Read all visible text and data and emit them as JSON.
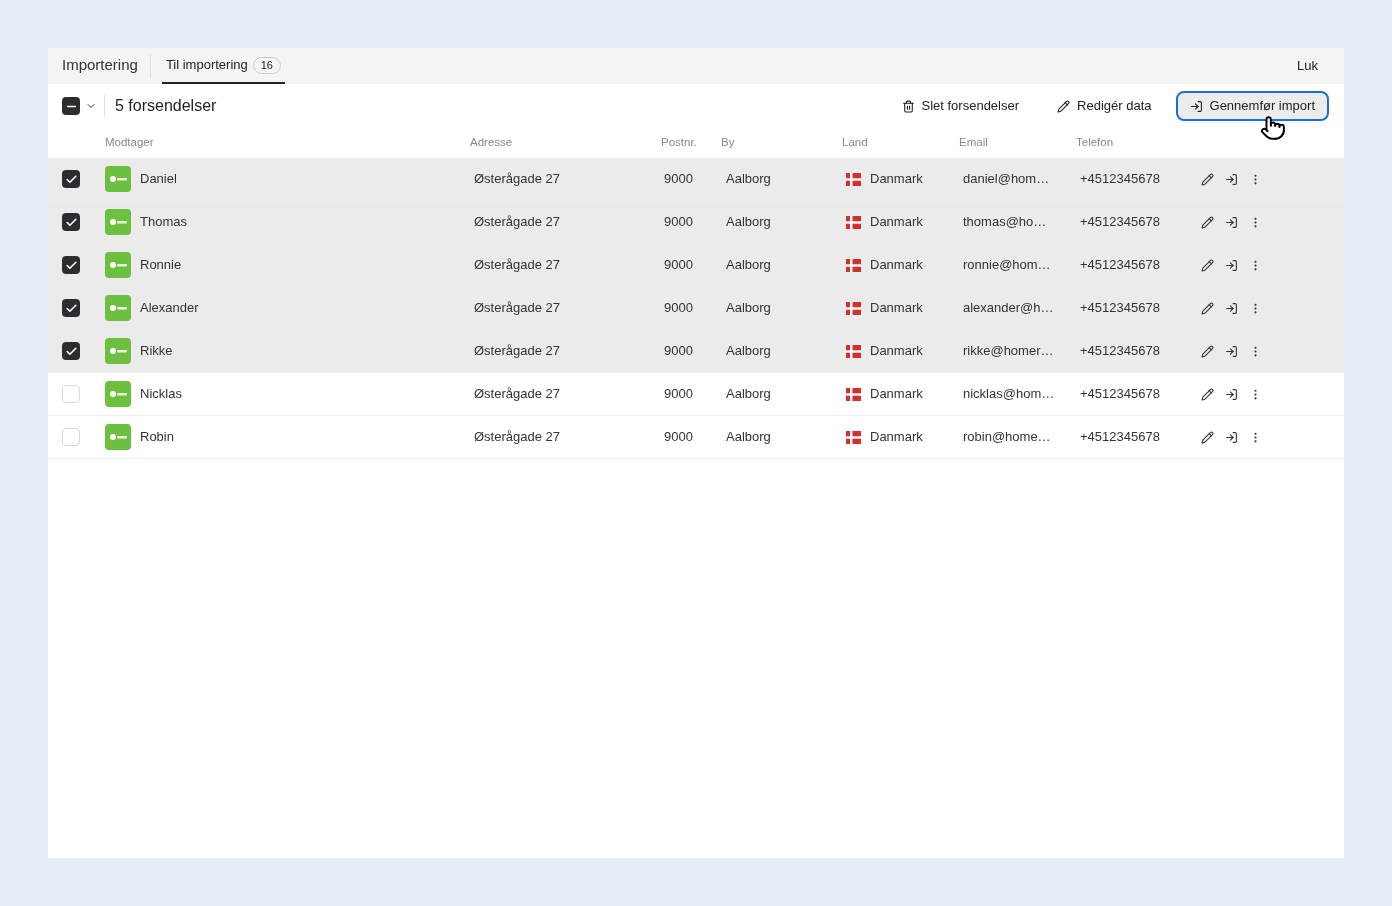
{
  "header": {
    "title": "Importering",
    "tabs": [
      {
        "label": "Til importering",
        "count": "16",
        "selected": true
      }
    ],
    "close": "Luk"
  },
  "toolbar": {
    "select_all": {
      "checked": true,
      "partial": true
    },
    "selection_count": "5 forsendelser",
    "actions": [
      {
        "kind": "delete",
        "label": "Slet forsendelser",
        "focused": false
      },
      {
        "kind": "edit",
        "label": "Redigér data",
        "focused": false
      },
      {
        "kind": "import",
        "label": "Gennemfør import",
        "focused": true
      }
    ]
  },
  "table": {
    "columns": [
      "Modtager",
      "Adresse",
      "Postnr.",
      "By",
      "Land",
      "Email",
      "Telefon"
    ],
    "rows": [
      {
        "checked": true,
        "name": "Daniel",
        "address": "Østerågade 27",
        "postal": "9000",
        "city": "Aalborg",
        "country": "Danmark",
        "email": "daniel@hom…",
        "phone": "+4512345678"
      },
      {
        "checked": true,
        "name": "Thomas",
        "address": "Østerågade 27",
        "postal": "9000",
        "city": "Aalborg",
        "country": "Danmark",
        "email": "thomas@ho…",
        "phone": "+4512345678"
      },
      {
        "checked": true,
        "name": "Ronnie",
        "address": "Østerågade 27",
        "postal": "9000",
        "city": "Aalborg",
        "country": "Danmark",
        "email": "ronnie@hom…",
        "phone": "+4512345678"
      },
      {
        "checked": true,
        "name": "Alexander",
        "address": "Østerågade 27",
        "postal": "9000",
        "city": "Aalborg",
        "country": "Danmark",
        "email": "alexander@h…",
        "phone": "+4512345678"
      },
      {
        "checked": true,
        "name": "Rikke",
        "address": "Østerågade 27",
        "postal": "9000",
        "city": "Aalborg",
        "country": "Danmark",
        "email": "rikke@homer…",
        "phone": "+4512345678"
      },
      {
        "checked": false,
        "name": "Nicklas",
        "address": "Østerågade 27",
        "postal": "9000",
        "city": "Aalborg",
        "country": "Danmark",
        "email": "nicklas@hom…",
        "phone": "+4512345678"
      },
      {
        "checked": false,
        "name": "Robin",
        "address": "Østerågade 27",
        "postal": "9000",
        "city": "Aalborg",
        "country": "Danmark",
        "email": "robin@home…",
        "phone": "+4512345678"
      }
    ]
  }
}
